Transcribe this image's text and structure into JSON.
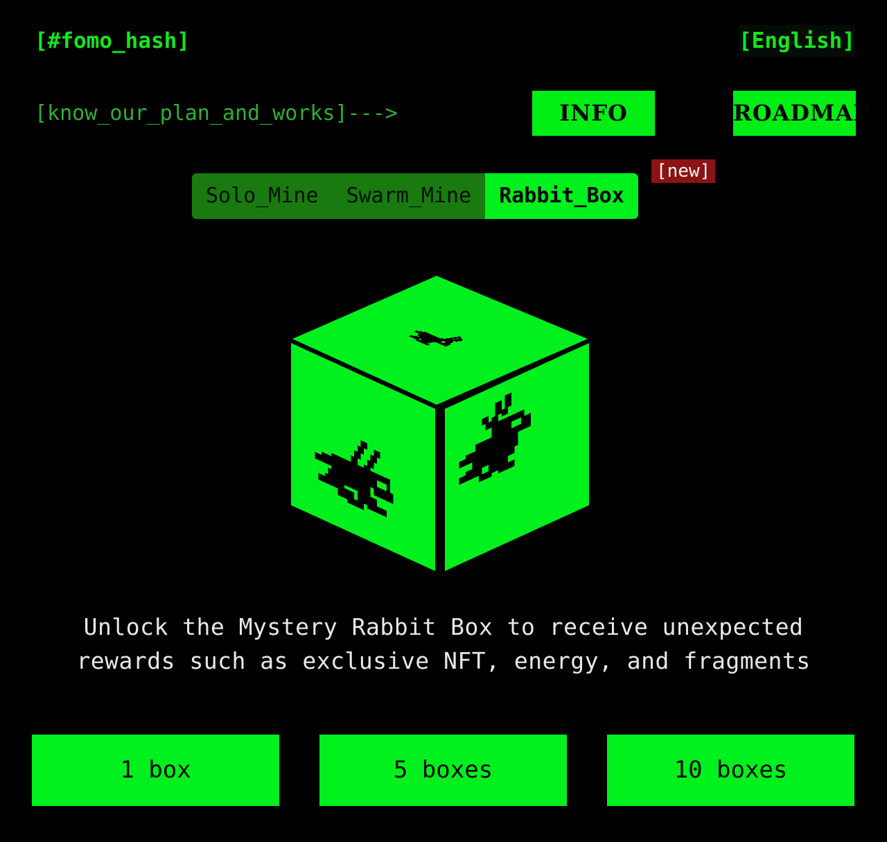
{
  "theme": {
    "background": "#000000",
    "accent_green": "#00f01e",
    "dim_green": "#187a0f",
    "text_green": "#14e61e",
    "muted_green": "#2faf35",
    "badge_red": "#8c1313",
    "body_text": "#e8e8e8"
  },
  "header": {
    "brand": "[#fomo_hash]",
    "language": "[English]",
    "tagline": "[know_our_plan_and_works]--->",
    "nav_buttons": [
      {
        "label": "INFO",
        "name": "info"
      },
      {
        "label": "ROADMAP",
        "name": "roadmap"
      }
    ]
  },
  "tabs": {
    "items": [
      {
        "label": "Solo_Mine",
        "active": false
      },
      {
        "label": "Swarm_Mine",
        "active": false
      },
      {
        "label": "Rabbit_Box",
        "active": true
      }
    ],
    "badge": "[new]"
  },
  "hero": {
    "icon_name": "mystery-rabbit-box-cube",
    "description": "Unlock the Mystery Rabbit Box to receive unexpected rewards such as exclusive NFT, energy, and fragments"
  },
  "purchase": {
    "options": [
      {
        "label": "1 box",
        "quantity": 1
      },
      {
        "label": "5 boxes",
        "quantity": 5
      },
      {
        "label": "10 boxes",
        "quantity": 10
      }
    ]
  }
}
